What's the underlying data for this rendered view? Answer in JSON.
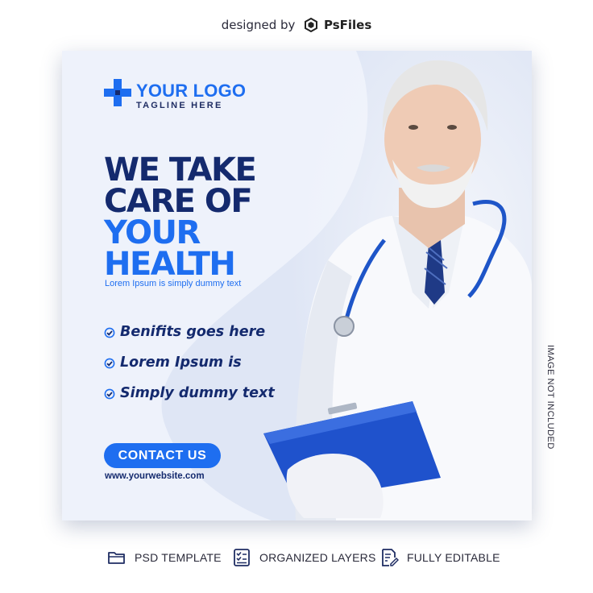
{
  "credit": {
    "prefix": "designed by",
    "brand": "PsFiles"
  },
  "logo": {
    "name": "YOUR LOGO",
    "tagline": "TAGLINE HERE"
  },
  "headline": {
    "line1": "WE TAKE",
    "line2": "CARE OF",
    "line3": "YOUR",
    "line4": "HEALTH"
  },
  "subtitle": "Lorem Ipsum is simply dummy text",
  "benefits": [
    "Benifits goes here",
    "Lorem Ipsum is",
    "Simply dummy text"
  ],
  "cta": {
    "label": "CONTACT US"
  },
  "website": "www.yourwebsite.com",
  "side_note": "IMAGE NOT INCLUDED",
  "features": [
    {
      "icon": "folder-icon",
      "label": "PSD TEMPLATE"
    },
    {
      "icon": "checklist-icon",
      "label": "ORGANIZED LAYERS"
    },
    {
      "icon": "edit-document-icon",
      "label": "FULLY EDITABLE"
    }
  ],
  "colors": {
    "primary_blue": "#1e6ef0",
    "navy": "#142a6e",
    "card_bg": "#dfe6f5",
    "wave_light": "#eef2fb"
  }
}
